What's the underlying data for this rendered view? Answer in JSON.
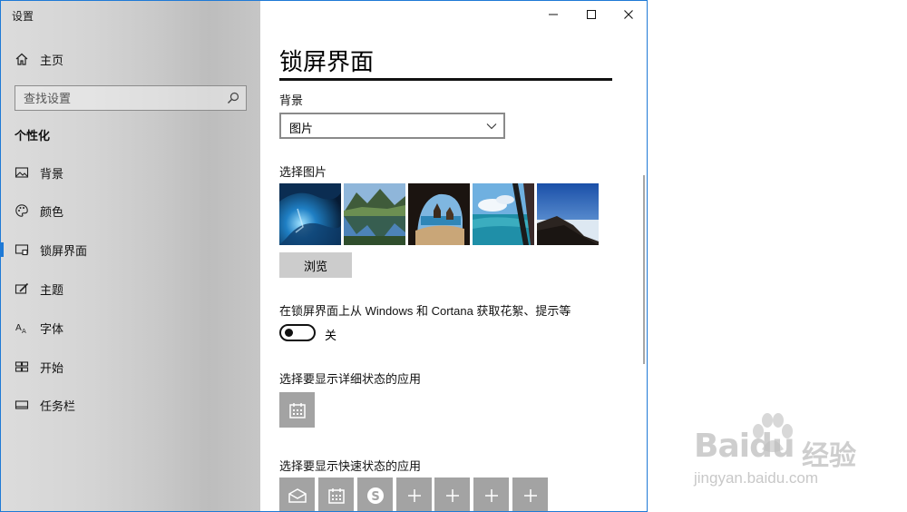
{
  "window": {
    "title": "设置"
  },
  "sidebar": {
    "home": {
      "label": "主页",
      "icon": "home-icon"
    },
    "search": {
      "placeholder": "查找设置",
      "icon": "search-icon"
    },
    "section_header": "个性化",
    "items": [
      {
        "label": "背景",
        "icon": "picture-icon",
        "active": false
      },
      {
        "label": "颜色",
        "icon": "palette-icon",
        "active": false
      },
      {
        "label": "锁屏界面",
        "icon": "lock-screen-icon",
        "active": true
      },
      {
        "label": "主题",
        "icon": "theme-brush-icon",
        "active": false
      },
      {
        "label": "字体",
        "icon": "font-icon",
        "active": false
      },
      {
        "label": "开始",
        "icon": "start-grid-icon",
        "active": false
      },
      {
        "label": "任务栏",
        "icon": "taskbar-icon",
        "active": false
      }
    ]
  },
  "content": {
    "title": "锁屏界面",
    "background": {
      "label": "背景",
      "selected": "图片"
    },
    "choose_picture": {
      "label": "选择图片",
      "thumbnails": [
        "ice-cave",
        "mountain-lake",
        "sea-arch-beach",
        "ocean-window",
        "mountain-clouds"
      ],
      "browse_label": "浏览"
    },
    "fun_facts": {
      "label": "在锁屏界面上从 Windows 和 Cortana 获取花絮、提示等",
      "state": "关",
      "on": false
    },
    "detailed_status": {
      "label": "选择要显示详细状态的应用",
      "apps": [
        "calendar-icon"
      ]
    },
    "quick_status": {
      "label": "选择要显示快速状态的应用",
      "apps": [
        "mail-icon",
        "calendar-icon",
        "skype-icon",
        "add-icon",
        "add-icon",
        "add-icon",
        "add-icon"
      ]
    }
  },
  "watermark": {
    "brand": "Baidu",
    "brand_cn": "经验",
    "url": "jingyan.baidu.com"
  },
  "colors": {
    "accent": "#1f7ad6",
    "tile": "#a3a3a3",
    "button": "#cccccc"
  }
}
